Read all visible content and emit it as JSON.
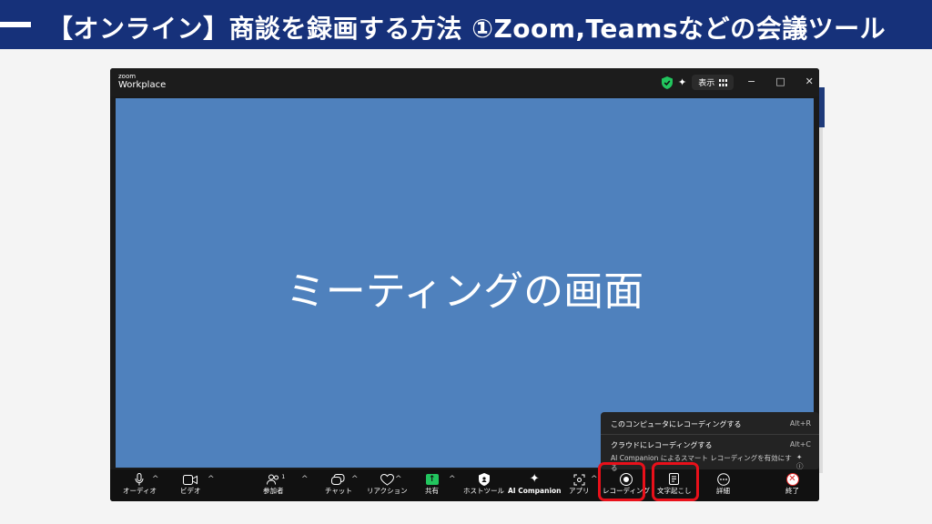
{
  "banner": {
    "title": "【オンライン】商談を録画する方法 ①Zoom,Teamsなどの会議ツール"
  },
  "window": {
    "logo_top": "zoom",
    "logo_bottom": "Workplace",
    "view_label": "表示",
    "minimize": "−",
    "maximize": "□",
    "close": "✕"
  },
  "meeting": {
    "screen_text": "ミーティングの画面"
  },
  "recording_menu": {
    "item_computer": "このコンピュータにレコーディングする",
    "item_computer_shortcut": "Alt+R",
    "item_cloud": "クラウドにレコーディングする",
    "item_cloud_shortcut": "Alt+C",
    "ai_smart_recording": "AI Companion によるスマート レコーディングを有効にする"
  },
  "toolbar": {
    "audio": "オーディオ",
    "video": "ビデオ",
    "participants": "参加者",
    "participants_count": "1",
    "chat": "チャット",
    "reactions": "リアクション",
    "share": "共有",
    "host_tools": "ホストツール",
    "ai_companion": "AI Companion",
    "apps": "アプリ",
    "recording": "レコーディング",
    "transcript": "文字起こし",
    "more": "詳細",
    "end": "終了"
  },
  "colors": {
    "banner": "#16317a",
    "meeting_bg": "#4f81bd",
    "highlight": "#e8101a",
    "share_green": "#22c55e"
  },
  "icons": {
    "security": "shield-check-icon",
    "ai": "sparkle-icon",
    "view": "grid-icon"
  }
}
